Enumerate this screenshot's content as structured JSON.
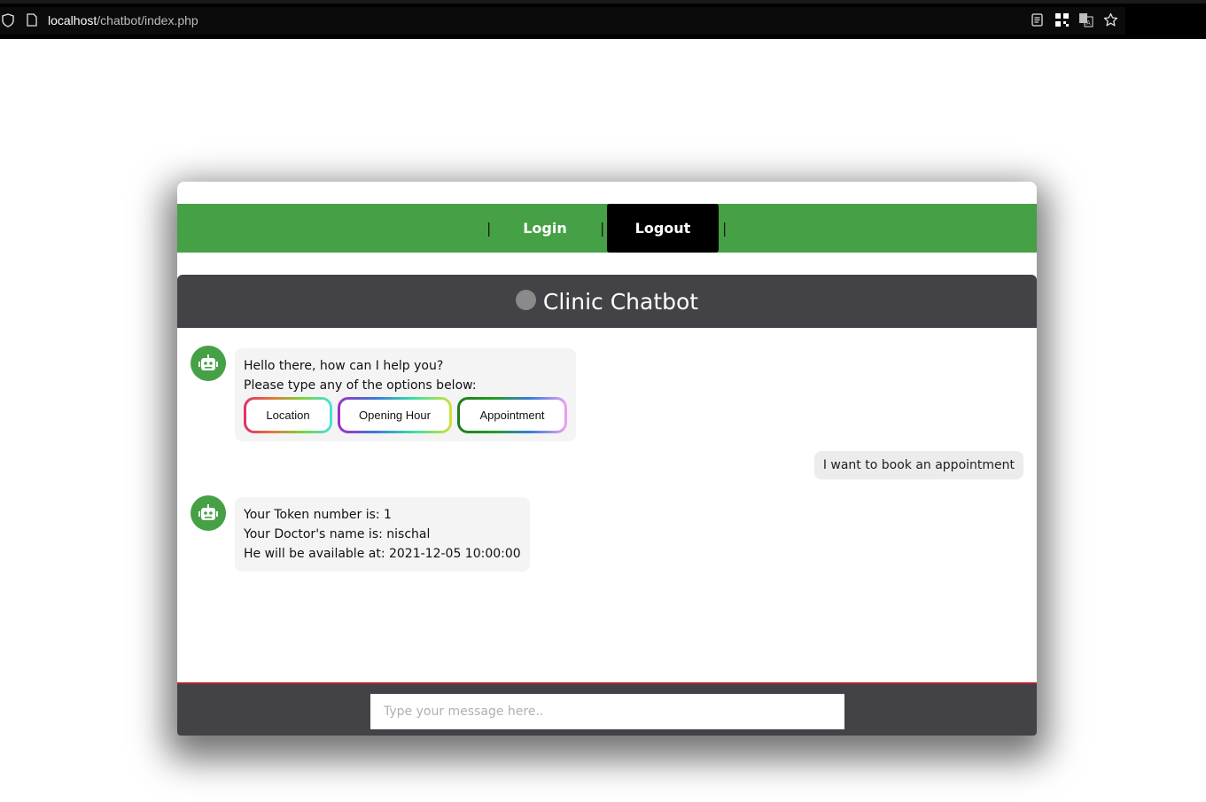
{
  "browser": {
    "url_host": "localhost",
    "url_path": "/chatbot/index.php"
  },
  "nav": {
    "separator": "|",
    "login_label": "Login",
    "logout_label": "Logout"
  },
  "chat": {
    "title": "Clinic Chatbot",
    "messages": [
      {
        "from": "bot",
        "lines": [
          "Hello there, how can I help you?",
          "Please type any of the options below:"
        ],
        "options": [
          "Location",
          "Opening Hour",
          "Appointment"
        ]
      },
      {
        "from": "user",
        "text": "I want to book an appointment"
      },
      {
        "from": "bot",
        "lines": [
          "Your Token number is: 1",
          "Your Doctor's name is: nischal",
          "He will be available at: 2021-12-05 10:00:00"
        ]
      }
    ],
    "input_placeholder": "Type your message here.."
  },
  "colors": {
    "nav_green": "#46a046",
    "header_dark": "#434347",
    "active_black": "#000000",
    "footer_accent": "#b02030"
  }
}
